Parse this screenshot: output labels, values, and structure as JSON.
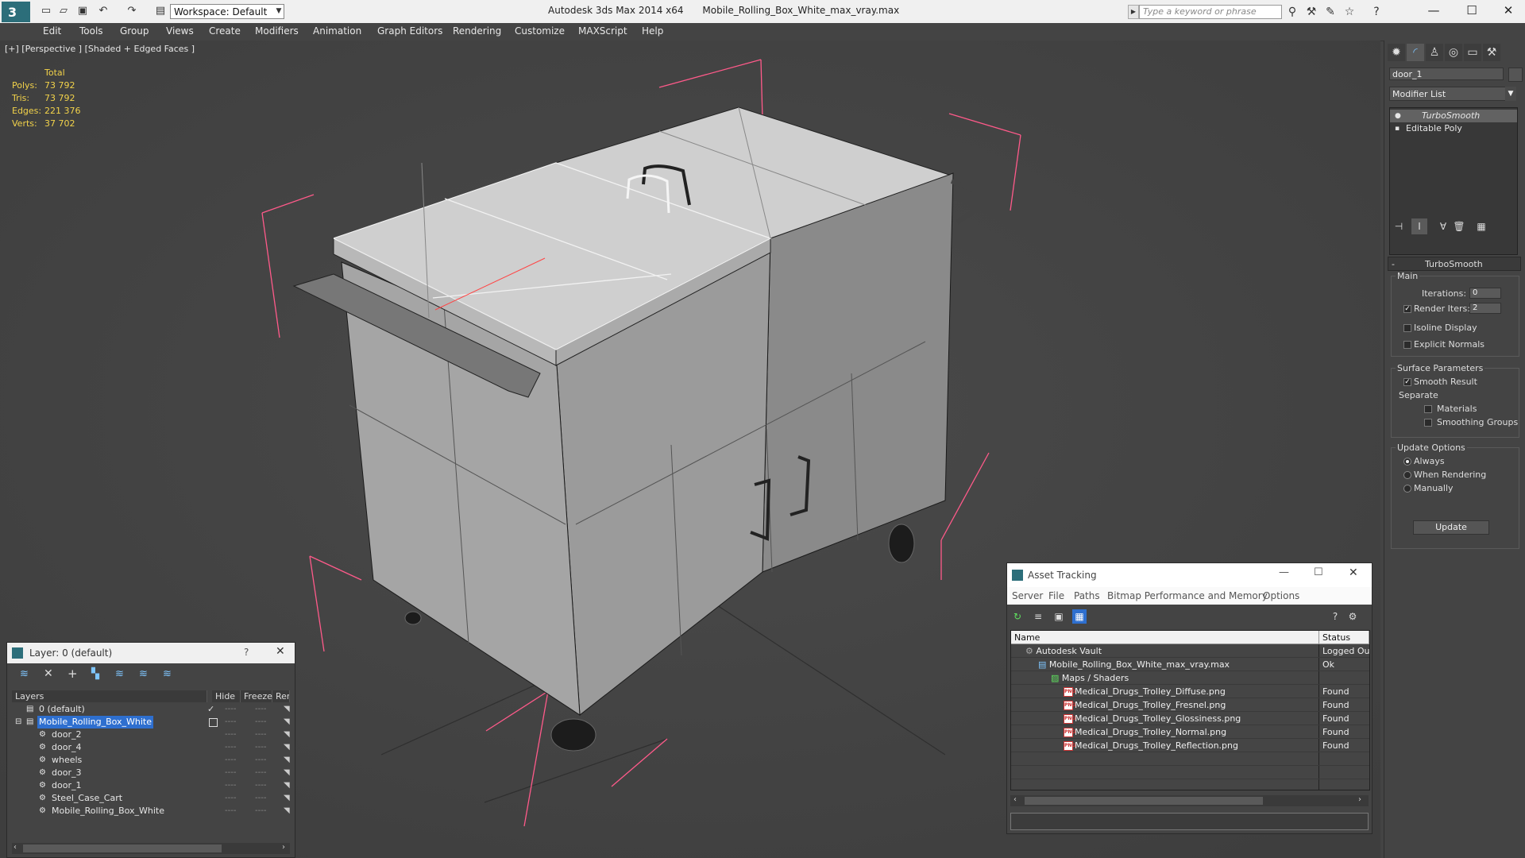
{
  "title_bar": {
    "app_name": "Autodesk 3ds Max  2014 x64",
    "file_name": "Mobile_Rolling_Box_White_max_vray.max",
    "workspace_label": "Workspace: Default",
    "search_placeholder": "Type a keyword or phrase"
  },
  "menu": [
    "Edit",
    "Tools",
    "Group",
    "Views",
    "Create",
    "Modifiers",
    "Animation",
    "Graph Editors",
    "Rendering",
    "Customize",
    "MAXScript",
    "Help"
  ],
  "viewport": {
    "label": "[+] [Perspective ] [Shaded + Edged Faces ]",
    "stats_header": "Total",
    "stats": [
      {
        "label": "Polys:",
        "value": "73 792"
      },
      {
        "label": "Tris:",
        "value": "73 792"
      },
      {
        "label": "Edges:",
        "value": "221 376"
      },
      {
        "label": "Verts:",
        "value": "37 702"
      }
    ]
  },
  "command_panel": {
    "object_name": "door_1",
    "modifier_list_label": "Modifier List",
    "stack": [
      "TurboSmooth",
      "Editable Poly"
    ],
    "rollout_title": "TurboSmooth",
    "main_group": "Main",
    "iterations_label": "Iterations:",
    "iterations_value": "0",
    "render_iters_label": "Render Iters:",
    "render_iters_value": "2",
    "isoline_label": "Isoline Display",
    "explicit_normals_label": "Explicit Normals",
    "surface_group": "Surface Parameters",
    "smooth_result_label": "Smooth Result",
    "separate_label": "Separate",
    "materials_label": "Materials",
    "smoothing_groups_label": "Smoothing Groups",
    "update_group": "Update Options",
    "always_label": "Always",
    "when_rendering_label": "When Rendering",
    "manually_label": "Manually",
    "update_button": "Update"
  },
  "layer_window": {
    "title": "Layer: 0 (default)",
    "help": "?",
    "columns": [
      "Layers",
      "Hide",
      "Freeze",
      "Ren"
    ],
    "rows": [
      {
        "name": "0 (default)",
        "indent": 0
      },
      {
        "name": "Mobile_Rolling_Box_White",
        "indent": 0
      },
      {
        "name": "door_2",
        "indent": 1
      },
      {
        "name": "door_4",
        "indent": 1
      },
      {
        "name": "wheels",
        "indent": 1
      },
      {
        "name": "door_3",
        "indent": 1
      },
      {
        "name": "door_1",
        "indent": 1
      },
      {
        "name": "Steel_Case_Cart",
        "indent": 1
      },
      {
        "name": "Mobile_Rolling_Box_White",
        "indent": 1
      }
    ],
    "dash": "----"
  },
  "asset_window": {
    "title": "Asset Tracking",
    "menu": [
      "Server",
      "File",
      "Paths",
      "Bitmap Performance and Memory",
      "Options"
    ],
    "columns": [
      "Name",
      "Status"
    ],
    "rows": [
      {
        "name": "Autodesk Vault",
        "status": "Logged Out",
        "level": 1,
        "icon": "vault"
      },
      {
        "name": "Mobile_Rolling_Box_White_max_vray.max",
        "status": "Ok",
        "level": 2,
        "icon": "max"
      },
      {
        "name": "Maps / Shaders",
        "status": "",
        "level": 3,
        "icon": "maps"
      },
      {
        "name": "Medical_Drugs_Trolley_Diffuse.png",
        "status": "Found",
        "level": 4,
        "icon": "png"
      },
      {
        "name": "Medical_Drugs_Trolley_Fresnel.png",
        "status": "Found",
        "level": 4,
        "icon": "png"
      },
      {
        "name": "Medical_Drugs_Trolley_Glossiness.png",
        "status": "Found",
        "level": 4,
        "icon": "png"
      },
      {
        "name": "Medical_Drugs_Trolley_Normal.png",
        "status": "Found",
        "level": 4,
        "icon": "png"
      },
      {
        "name": "Medical_Drugs_Trolley_Reflection.png",
        "status": "Found",
        "level": 4,
        "icon": "png"
      }
    ],
    "png_badge": "PNG"
  },
  "colors": {
    "accent": "#2e6fcf",
    "stats": "#f2d24a",
    "bounding_box": "#ff5a8a",
    "viewport_bg": "#454545"
  }
}
